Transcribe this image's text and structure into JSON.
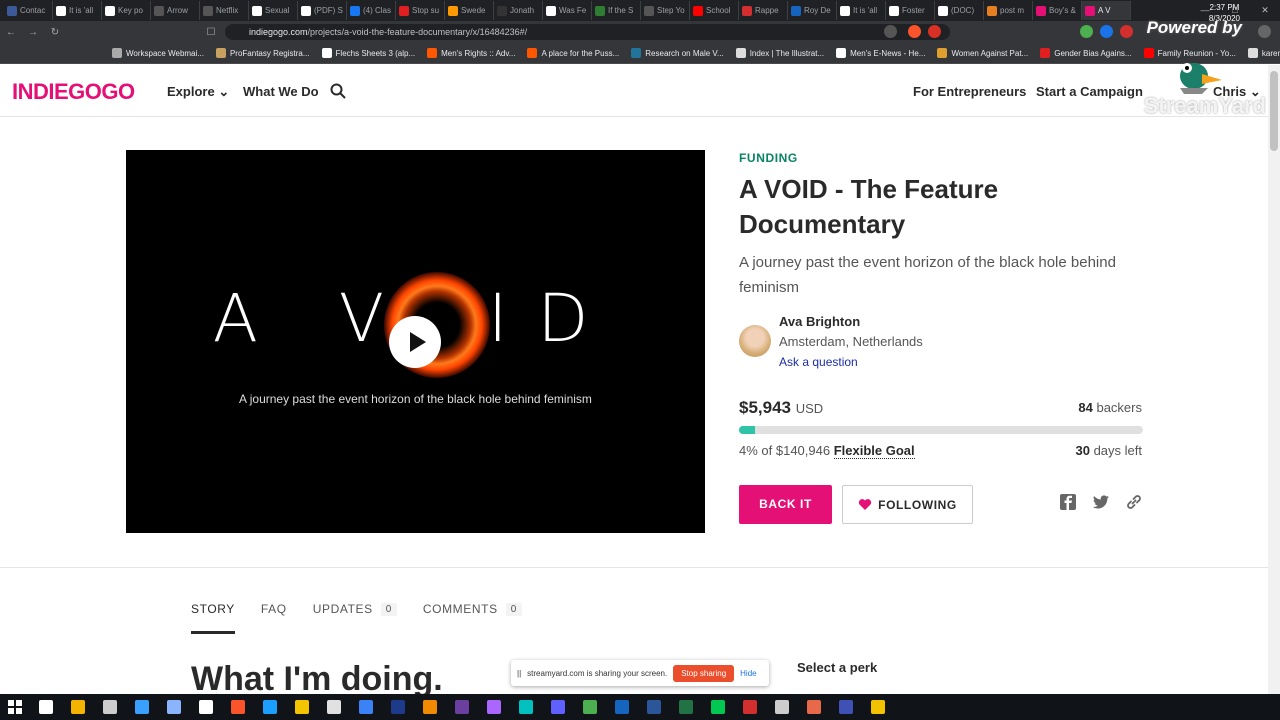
{
  "browser": {
    "tabs": [
      {
        "label": "Contac",
        "color": "#3c5a99"
      },
      {
        "label": "It is 'all",
        "color": "#ffffff"
      },
      {
        "label": "Key po",
        "color": "#ffffff"
      },
      {
        "label": "Arrow",
        "color": "#555555"
      },
      {
        "label": "Netflix",
        "color": "#555555"
      },
      {
        "label": "Sexual",
        "color": "#ffffff"
      },
      {
        "label": "(PDF) S",
        "color": "#ffffff"
      },
      {
        "label": "(4) Clas",
        "color": "#1877f2"
      },
      {
        "label": "Stop su",
        "color": "#e02020"
      },
      {
        "label": "Swede",
        "color": "#ff9900"
      },
      {
        "label": "Jonath",
        "color": "#333333"
      },
      {
        "label": "Was Fe",
        "color": "#ffffff"
      },
      {
        "label": "If the S",
        "color": "#2e7d32"
      },
      {
        "label": "Step Yo",
        "color": "#555555"
      },
      {
        "label": "School",
        "color": "#ff0000"
      },
      {
        "label": "Rappe",
        "color": "#d32f2f"
      },
      {
        "label": "Roy De",
        "color": "#1565c0"
      },
      {
        "label": "It is 'all",
        "color": "#ffffff"
      },
      {
        "label": "Foster",
        "color": "#ffffff"
      },
      {
        "label": "(DOC)",
        "color": "#ffffff"
      },
      {
        "label": "post m",
        "color": "#e67e22"
      },
      {
        "label": "Boy's &",
        "color": "#e51075"
      },
      {
        "label": "A V",
        "color": "#e51075"
      }
    ],
    "url_host": "indiegogo.com",
    "url_path": "/projects/a-void-the-feature-documentary/x/16484236#/",
    "bookmarks": [
      {
        "label": "Workspace Webmai...",
        "color": "#aaaaaa"
      },
      {
        "label": "ProFantasy Registra...",
        "color": "#c8a060"
      },
      {
        "label": "Flechs Sheets 3 (alp...",
        "color": "#ffffff"
      },
      {
        "label": "Men's Rights :: Adv...",
        "color": "#ff5700"
      },
      {
        "label": "A place for the Puss...",
        "color": "#ff5700"
      },
      {
        "label": "Research on Male V...",
        "color": "#21759b"
      },
      {
        "label": "Index | The Illustrat...",
        "color": "#dddddd"
      },
      {
        "label": "Men's E-News - He...",
        "color": "#ffffff"
      },
      {
        "label": "Women Against Pat...",
        "color": "#e0a030"
      },
      {
        "label": "Gender Bias Agains...",
        "color": "#e02020"
      },
      {
        "label": "Family Reunion - Yo...",
        "color": "#ff0000"
      },
      {
        "label": "karen",
        "color": "#dddddd"
      }
    ]
  },
  "overlay": {
    "powered_by": "Powered by",
    "streamyard": "StreamYard"
  },
  "header": {
    "logo": "INDIEGOGO",
    "explore": "Explore",
    "what_we_do": "What We Do",
    "for_entrepreneurs": "For Entrepreneurs",
    "start_campaign": "Start a Campaign",
    "user": "Chris"
  },
  "video": {
    "title_left": "A V",
    "title_right": "ID",
    "subtitle": "A journey past the event horizon of the black hole behind feminism"
  },
  "campaign": {
    "category": "FUNDING",
    "title": "A VOID - The Feature Documentary",
    "subtitle": "A journey past the event horizon of the black hole behind feminism",
    "owner": "Ava Brighton",
    "location": "Amsterdam, Netherlands",
    "ask": "Ask a question",
    "raised": "$5,943",
    "currency": "USD",
    "backers_count": "84",
    "backers_label": "backers",
    "percent_text": "4% of $140,946",
    "goal_type": "Flexible Goal",
    "days_count": "30",
    "days_label": "days left",
    "progress": 0.04,
    "back_label": "BACK IT",
    "follow_label": "FOLLOWING",
    "accent": "#e51075",
    "progress_color": "#2fc4a7"
  },
  "content": {
    "tabs": [
      {
        "label": "STORY",
        "count": ""
      },
      {
        "label": "FAQ",
        "count": ""
      },
      {
        "label": "UPDATES",
        "count": "0"
      },
      {
        "label": "COMMENTS",
        "count": "0"
      }
    ],
    "heading": "What I'm doing.",
    "select_perk": "Select a perk"
  },
  "share_bar": {
    "text": "streamyard.com is sharing your screen.",
    "stop": "Stop sharing",
    "hide": "Hide"
  },
  "taskbar": {
    "time": "2:37 PM",
    "date": "8/3/2020",
    "icons": [
      "#ffffff",
      "#f4b400",
      "#cccccc",
      "#3aa0ff",
      "#8bb4ff",
      "#ffffff",
      "#fb542b",
      "#1a9fff",
      "#f5c400",
      "#e1e1e1",
      "#3b82f6",
      "#1e3a8a",
      "#f08a00",
      "#6b3fa0",
      "#aa66ff",
      "#00c0c0",
      "#6060ff",
      "#4caf50",
      "#1565c0",
      "#2b579a",
      "#217346",
      "#00c853",
      "#d32f2f",
      "#cccccc",
      "#e8684a",
      "#3f51b5",
      "#f2c200"
    ]
  }
}
